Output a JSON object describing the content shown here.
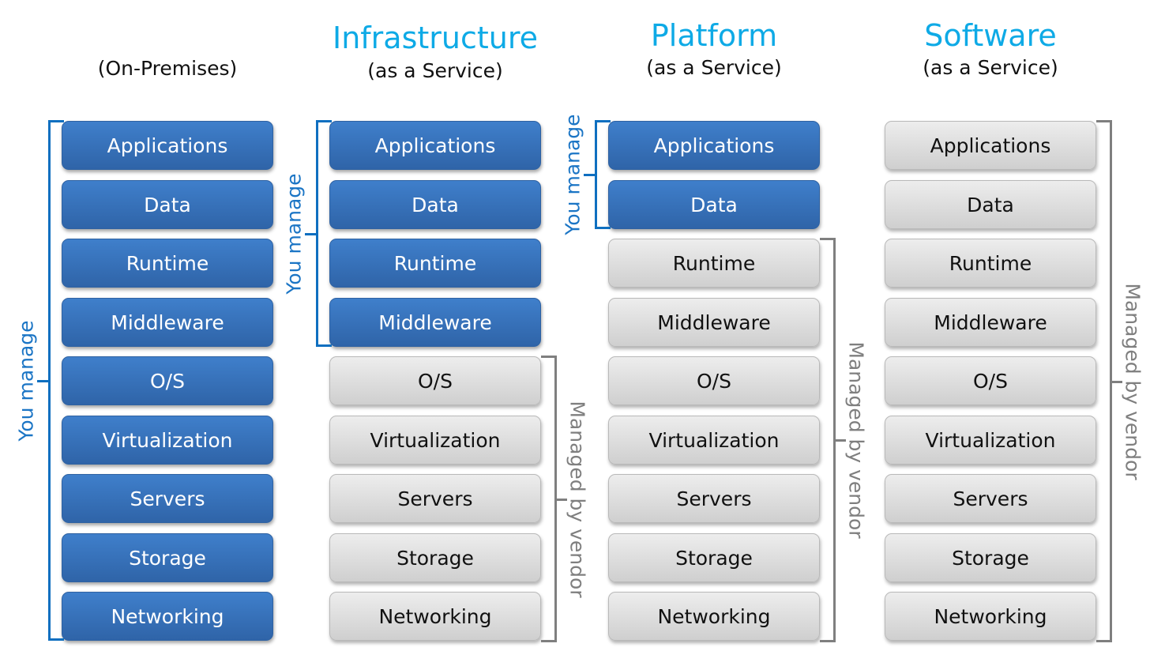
{
  "colors": {
    "title_accent": "#0eaae6",
    "you_manage_fill": "#3a75c0",
    "you_manage_bracket": "#0f6fc0",
    "vendor_fill": "#dcdcdc",
    "vendor_bracket": "#7f7f7f"
  },
  "layers": [
    "Applications",
    "Data",
    "Runtime",
    "Middleware",
    "O/S",
    "Virtualization",
    "Servers",
    "Storage",
    "Networking"
  ],
  "columns": [
    {
      "title": "",
      "subtitle": "(On-Premises)",
      "you_manage_count": 9,
      "you_manage_label": "You manage",
      "vendor_label": ""
    },
    {
      "title": "Infrastructure",
      "subtitle": "(as a Service)",
      "you_manage_count": 4,
      "you_manage_label": "You manage",
      "vendor_label": "Managed by vendor"
    },
    {
      "title": "Platform",
      "subtitle": "(as a Service)",
      "you_manage_count": 2,
      "you_manage_label": "You manage",
      "vendor_label": "Managed by vendor"
    },
    {
      "title": "Software",
      "subtitle": "(as a Service)",
      "you_manage_count": 0,
      "you_manage_label": "",
      "vendor_label": "Managed by vendor"
    }
  ]
}
